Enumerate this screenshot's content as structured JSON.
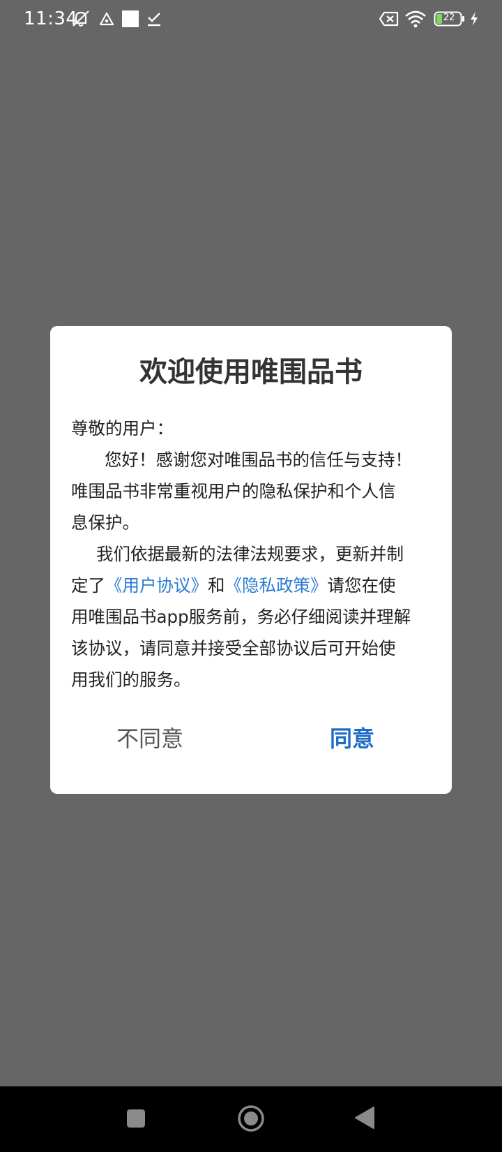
{
  "status_bar": {
    "time": "11:34",
    "left_icons": [
      "mute-notification-icon",
      "navigation-triangle-icon",
      "white-square-icon",
      "download-check-icon"
    ],
    "right_icons": [
      "sim-x-icon",
      "wifi-icon",
      "battery-icon",
      "charging-bolt-icon"
    ],
    "battery_level": "22"
  },
  "dialog": {
    "title": "欢迎使用唯围品书",
    "lines": {
      "l1": "尊敬的用户：",
      "l2": "您好！感谢您对唯围品书的信任与支持！",
      "l3": "唯围品书非常重视用户的隐私保护和个人信",
      "l4": "息保护。",
      "l5": "我们依据最新的法律法规要求，更新并制",
      "l6_a": "定了",
      "l6_link1": "《用户协议》",
      "l6_b": "和",
      "l6_link2": "《隐私政策》",
      "l6_c": "请您在使",
      "l7": "用唯围品书app服务前，务必仔细阅读并理解",
      "l8": "该协议，请同意并接受全部协议后可开始使",
      "l9": "用我们的服务。"
    },
    "disagree_label": "不同意",
    "agree_label": "同意"
  },
  "nav_bar": {
    "icons": [
      "recents-square-icon",
      "home-circle-icon",
      "back-triangle-icon"
    ]
  },
  "colors": {
    "overlay": "#666666",
    "link": "#2a7bd4",
    "agree": "#1f6cc6",
    "nav_bg": "#000000"
  }
}
